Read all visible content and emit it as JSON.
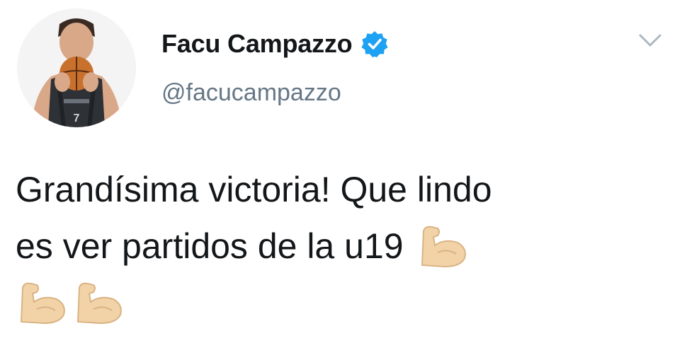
{
  "tweet": {
    "author": {
      "display_name": "Facu Campazzo",
      "handle": "@facucampazzo",
      "verified": true,
      "avatar_icon": "player-avatar-icon",
      "jersey_number": "7"
    },
    "text_lines": [
      "Grandísima victoria! Que lindo",
      "es ver partidos de la u19"
    ],
    "emojis": [
      "flexed-biceps",
      "flexed-biceps",
      "flexed-biceps"
    ],
    "menu_icon": "chevron-down-icon"
  },
  "colors": {
    "text": "#14171a",
    "secondary": "#657786",
    "verified_blue": "#1da1f2",
    "chevron": "#aab8c2",
    "emoji_skin": "#f2d3a8"
  }
}
